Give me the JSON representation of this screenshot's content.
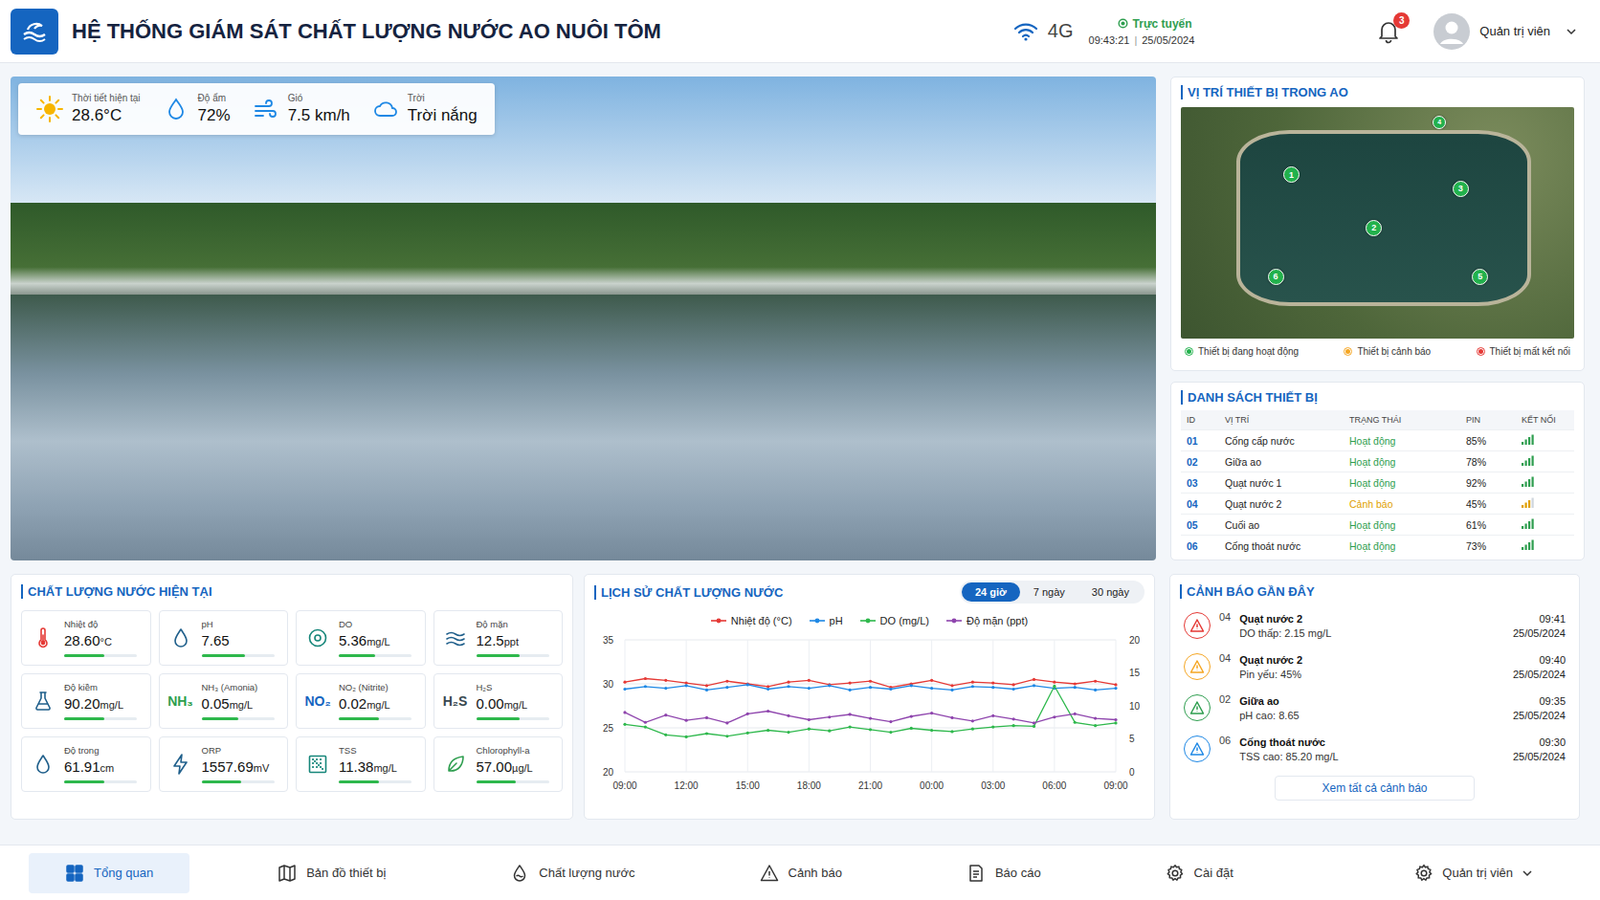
{
  "header": {
    "title": "HỆ THỐNG GIÁM SÁT CHẤT LƯỢNG NƯỚC AO NUÔI TÔM",
    "network": "4G",
    "status": "Trực tuyến",
    "online": true,
    "time": "09:43:21",
    "separator": "|",
    "date": "25/05/2024",
    "notifications": "3",
    "user": "Quản trị viên"
  },
  "weather": [
    {
      "kind": "sun",
      "label": "Thời tiết hiện tại",
      "value": "28.6°C"
    },
    {
      "kind": "drop",
      "label": "Độ ẩm",
      "value": "72%"
    },
    {
      "kind": "wind",
      "label": "Gió",
      "value": "7.5 km/h"
    },
    {
      "kind": "cloud",
      "label": "Trời",
      "value": "Trời nắng"
    }
  ],
  "map": {
    "title": "VỊ TRÍ THIẾT BỊ TRONG AO",
    "pins": [
      {
        "label": "1",
        "color": "#22b14c"
      },
      {
        "label": "3",
        "color": "#22b14c"
      },
      {
        "label": "2",
        "color": "#22b14c"
      },
      {
        "label": "6",
        "color": "#22b14c"
      },
      {
        "label": "5",
        "color": "#22b14c"
      },
      {
        "label": "4",
        "color": "#22b14c"
      }
    ],
    "legend": [
      {
        "label": "Thiết bị đang hoạt động",
        "color": "#22b14c"
      },
      {
        "label": "Thiết bị cảnh báo",
        "color": "#f5a623"
      },
      {
        "label": "Thiết bị mất kết nối",
        "color": "#e53935"
      }
    ]
  },
  "devices": {
    "title": "DANH SÁCH THIẾT BỊ",
    "columns": [
      "ID",
      "VỊ TRÍ",
      "TRẠNG THÁI",
      "PIN",
      "KẾT NỐI"
    ],
    "rows": [
      {
        "id": "01",
        "location": "Cống cấp nước",
        "status": "Hoạt động",
        "color": "#2e9e4f",
        "battery": "85%",
        "signal": 1
      },
      {
        "id": "02",
        "location": "Giữa ao",
        "status": "Hoạt động",
        "color": "#2e9e4f",
        "battery": "78%",
        "signal": 1
      },
      {
        "id": "03",
        "location": "Quạt nước 1",
        "status": "Hoạt động",
        "color": "#2e9e4f",
        "battery": "92%",
        "signal": 1
      },
      {
        "id": "04",
        "location": "Quạt nước 2",
        "status": "Cảnh báo",
        "color": "#e0a000",
        "battery": "45%",
        "signal": 0.75
      },
      {
        "id": "05",
        "location": "Cuối ao",
        "status": "Hoạt động",
        "color": "#2e9e4f",
        "battery": "61%",
        "signal": 1
      },
      {
        "id": "06",
        "location": "Cống thoát nước",
        "status": "Hoạt động",
        "color": "#2e9e4f",
        "battery": "73%",
        "signal": 1
      }
    ]
  },
  "quality": {
    "title": "CHẤT LƯỢNG NƯỚC HIỆN TẠI",
    "metrics": [
      {
        "kind": "thermometer",
        "label": "Nhiệt độ",
        "value": "28.60",
        "unit": "°C",
        "level": 0.55,
        "color": "#e53935"
      },
      {
        "kind": "drop",
        "label": "pH",
        "value": "7.65",
        "unit": "",
        "level": 0.6,
        "color": "#1f5f8b"
      },
      {
        "kind": "target",
        "label": "DO",
        "value": "5.36",
        "unit": "mg/L",
        "level": 0.5,
        "color": "#16867a"
      },
      {
        "kind": "waves",
        "label": "Độ mặn",
        "value": "12.5",
        "unit": "ppt",
        "level": 0.6,
        "color": "#1f5f8b"
      },
      {
        "kind": "flask",
        "label": "Độ kiềm",
        "value": "90.20",
        "unit": "mg/L",
        "level": 0.55,
        "color": "#1f5f8b"
      },
      {
        "kind": "symbol",
        "symbol": "NH₃",
        "label": "NH₃ (Amonia)",
        "value": "0.05",
        "unit": "mg/L",
        "level": 0.5,
        "color": "#2e9e4f"
      },
      {
        "kind": "symbol",
        "symbol": "NO₂",
        "label": "NO₂ (Nitrite)",
        "value": "0.02",
        "unit": "mg/L",
        "level": 0.55,
        "color": "#1565c0"
      },
      {
        "kind": "symbol",
        "symbol": "H₂S",
        "label": "H₂S",
        "value": "0.00",
        "unit": "mg/L",
        "level": 0.6,
        "color": "#37474f"
      },
      {
        "kind": "drop",
        "label": "Độ trong",
        "value": "61.91",
        "unit": "cm",
        "level": 0.55,
        "color": "#1f5f8b"
      },
      {
        "kind": "bolt",
        "label": "ORP",
        "value": "1557.69",
        "unit": "mV",
        "level": 0.55,
        "color": "#1f5f8b"
      },
      {
        "kind": "dots",
        "label": "TSS",
        "value": "11.38",
        "unit": "mg/L",
        "level": 0.55,
        "color": "#16867a"
      },
      {
        "kind": "leaf",
        "label": "Chlorophyll-a",
        "value": "57.00",
        "unit": "µg/L",
        "level": 0.55,
        "color": "#2e9e4f"
      }
    ]
  },
  "history": {
    "title": "LỊCH SỬ CHẤT LƯỢNG NƯỚC",
    "ranges": [
      {
        "label": "24 giờ",
        "selected": true
      },
      {
        "label": "7 ngày",
        "selected": false
      },
      {
        "label": "30 ngày",
        "selected": false
      }
    ],
    "left_ticks": [
      "35",
      "30",
      "25",
      "20"
    ],
    "right_ticks": [
      "20",
      "15",
      "10",
      "5",
      "0"
    ],
    "x_ticks": [
      "09:00",
      "12:00",
      "15:00",
      "18:00",
      "21:00",
      "00:00",
      "03:00",
      "06:00",
      "09:00"
    ],
    "series": [
      {
        "name": "Nhiệt độ (°C)",
        "color": "#e53935",
        "axis": "left",
        "values": [
          30.2,
          30.6,
          30.4,
          30.1,
          29.8,
          30.3,
          30.0,
          29.7,
          30.2,
          30.4,
          29.9,
          30.1,
          30.3,
          29.6,
          30.0,
          30.4,
          29.8,
          30.2,
          30.1,
          29.9,
          30.5,
          30.2,
          30.0,
          30.3,
          29.9
        ]
      },
      {
        "name": "pH",
        "color": "#1e88e5",
        "axis": "left",
        "values": [
          29.4,
          29.7,
          29.5,
          29.8,
          29.3,
          29.6,
          29.9,
          29.4,
          29.7,
          29.5,
          29.8,
          29.3,
          29.6,
          29.4,
          29.8,
          29.5,
          29.3,
          29.7,
          29.6,
          29.4,
          29.8,
          29.5,
          29.6,
          29.3,
          29.5
        ]
      },
      {
        "name": "DO (mg/L)",
        "color": "#2eb84c",
        "axis": "right",
        "values": [
          7.2,
          6.8,
          5.6,
          5.3,
          5.8,
          5.4,
          5.9,
          6.3,
          6.0,
          6.5,
          6.2,
          6.8,
          6.4,
          6.0,
          6.6,
          6.3,
          6.1,
          6.5,
          6.8,
          7.0,
          6.9,
          13.0,
          7.5,
          7.0,
          7.4
        ]
      },
      {
        "name": "Độ mặn (ppt)",
        "color": "#8e44ad",
        "axis": "right",
        "values": [
          9.0,
          7.5,
          8.6,
          7.8,
          8.2,
          7.4,
          8.8,
          9.2,
          8.5,
          7.9,
          8.3,
          8.7,
          8.1,
          7.6,
          8.4,
          8.9,
          8.2,
          7.7,
          8.5,
          8.0,
          7.4,
          8.3,
          8.8,
          8.1,
          7.9
        ]
      }
    ]
  },
  "alerts": {
    "title": "CẢNH BÁO GẦN ĐÂY",
    "items": [
      {
        "id": "04",
        "title": "Quạt nước 2",
        "message": "DO thấp: 2.15 mg/L",
        "time": "09:41",
        "date": "25/05/2024",
        "color": "#e53935"
      },
      {
        "id": "04",
        "title": "Quạt nước 2",
        "message": "Pin yếu: 45%",
        "time": "09:40",
        "date": "25/05/2024",
        "color": "#f5a623"
      },
      {
        "id": "02",
        "title": "Giữa ao",
        "message": "pH cao: 8.65",
        "time": "09:35",
        "date": "25/05/2024",
        "color": "#2e9e4f"
      },
      {
        "id": "06",
        "title": "Cống thoát nước",
        "message": "TSS cao: 85.20 mg/L",
        "time": "09:30",
        "date": "25/05/2024",
        "color": "#1e88e5"
      }
    ],
    "more": "Xem tất cả cảnh báo"
  },
  "nav": {
    "items": [
      {
        "kind": "grid",
        "label": "Tổng quan",
        "selected": true
      },
      {
        "kind": "map",
        "label": "Bản đồ thiết bị",
        "selected": false
      },
      {
        "kind": "drop",
        "label": "Chất lượng nước",
        "selected": false
      },
      {
        "kind": "warning",
        "label": "Cảnh báo",
        "selected": false
      },
      {
        "kind": "report",
        "label": "Báo cáo",
        "selected": false
      },
      {
        "kind": "gear",
        "label": "Cài đặt",
        "selected": false
      }
    ],
    "user": "Quản trị viên"
  }
}
